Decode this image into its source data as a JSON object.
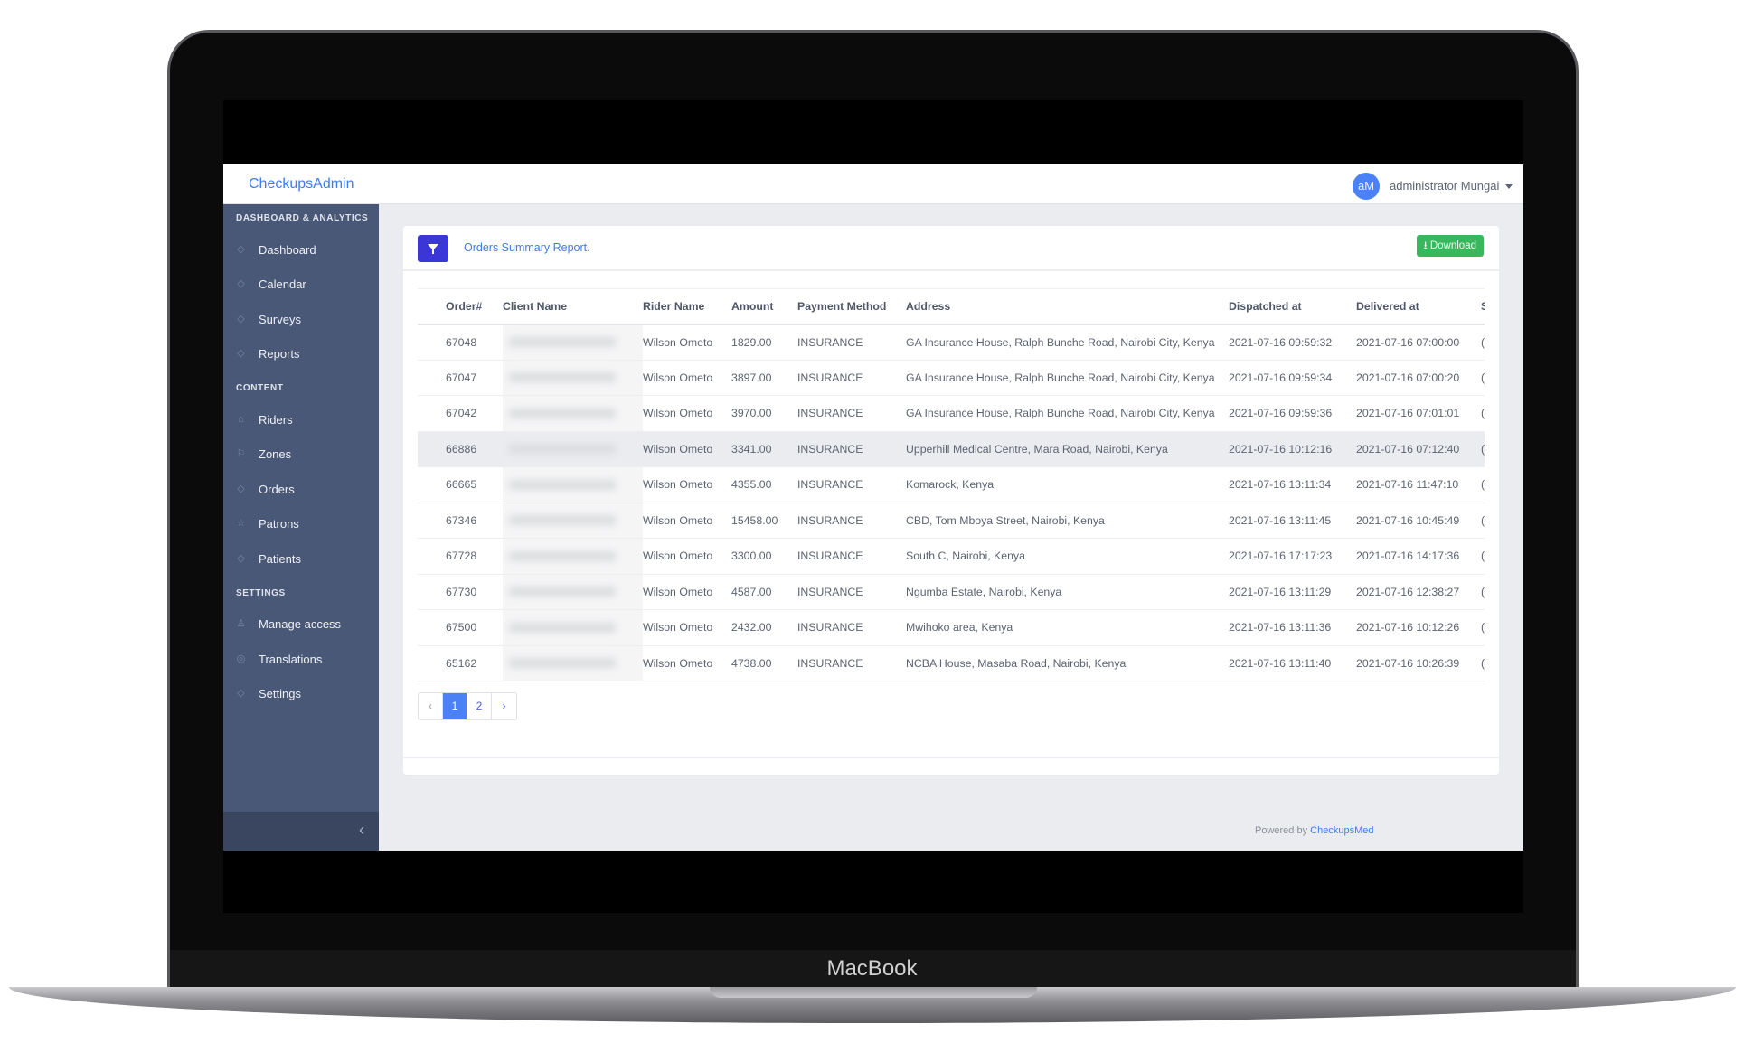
{
  "device": {
    "brand": "MacBook"
  },
  "header": {
    "logo": "CheckupsAdmin",
    "avatar_initials": "aM",
    "user_name": "administrator Mungai"
  },
  "sidebar": {
    "sections": [
      {
        "title": "DASHBOARD & ANALYTICS",
        "items": [
          {
            "label": "Dashboard",
            "icon": "diamond-icon"
          },
          {
            "label": "Calendar",
            "icon": "diamond-icon"
          },
          {
            "label": "Surveys",
            "icon": "diamond-icon"
          },
          {
            "label": "Reports",
            "icon": "diamond-icon"
          }
        ]
      },
      {
        "title": "CONTENT",
        "items": [
          {
            "label": "Riders",
            "icon": "graduation-cap-icon"
          },
          {
            "label": "Zones",
            "icon": "flag-icon"
          },
          {
            "label": "Orders",
            "icon": "diamond-icon"
          },
          {
            "label": "Patrons",
            "icon": "star-icon"
          },
          {
            "label": "Patients",
            "icon": "diamond-icon"
          }
        ]
      },
      {
        "title": "SETTINGS",
        "items": [
          {
            "label": "Manage access",
            "icon": "user-icon"
          },
          {
            "label": "Translations",
            "icon": "map-pin-icon"
          },
          {
            "label": "Settings",
            "icon": "diamond-icon"
          }
        ]
      }
    ],
    "collapse_icon": "‹"
  },
  "card": {
    "title": "Orders Summary Report.",
    "download_label": "Download",
    "accent": "#3a36d8",
    "download_color": "#39b75d"
  },
  "table": {
    "columns": [
      "Order#",
      "Client Name",
      "Rider Name",
      "Amount",
      "Payment Method",
      "Address",
      "Dispatched at",
      "Delivered at",
      "S"
    ],
    "rows": [
      {
        "order": "67048",
        "rider": "Wilson Ometo",
        "amount": "1829.00",
        "payment": "INSURANCE",
        "address": "GA Insurance House, Ralph Bunche Road, Nairobi City, Kenya",
        "dispatched": "2021-07-16 09:59:32",
        "delivered": "2021-07-16 07:00:00",
        "s": "("
      },
      {
        "order": "67047",
        "rider": "Wilson Ometo",
        "amount": "3897.00",
        "payment": "INSURANCE",
        "address": "GA Insurance House, Ralph Bunche Road, Nairobi City, Kenya",
        "dispatched": "2021-07-16 09:59:34",
        "delivered": "2021-07-16 07:00:20",
        "s": "("
      },
      {
        "order": "67042",
        "rider": "Wilson Ometo",
        "amount": "3970.00",
        "payment": "INSURANCE",
        "address": "GA Insurance House, Ralph Bunche Road, Nairobi City, Kenya",
        "dispatched": "2021-07-16 09:59:36",
        "delivered": "2021-07-16 07:01:01",
        "s": "("
      },
      {
        "order": "66886",
        "rider": "Wilson Ometo",
        "amount": "3341.00",
        "payment": "INSURANCE",
        "address": "Upperhill Medical Centre, Mara Road, Nairobi, Kenya",
        "dispatched": "2021-07-16 10:12:16",
        "delivered": "2021-07-16 07:12:40",
        "s": "("
      },
      {
        "order": "66665",
        "rider": "Wilson Ometo",
        "amount": "4355.00",
        "payment": "INSURANCE",
        "address": "Komarock, Kenya",
        "dispatched": "2021-07-16 13:11:34",
        "delivered": "2021-07-16 11:47:10",
        "s": "("
      },
      {
        "order": "67346",
        "rider": "Wilson Ometo",
        "amount": "15458.00",
        "payment": "INSURANCE",
        "address": "CBD, Tom Mboya Street, Nairobi, Kenya",
        "dispatched": "2021-07-16 13:11:45",
        "delivered": "2021-07-16 10:45:49",
        "s": "("
      },
      {
        "order": "67728",
        "rider": "Wilson Ometo",
        "amount": "3300.00",
        "payment": "INSURANCE",
        "address": "South C, Nairobi, Kenya",
        "dispatched": "2021-07-16 17:17:23",
        "delivered": "2021-07-16 14:17:36",
        "s": "("
      },
      {
        "order": "67730",
        "rider": "Wilson Ometo",
        "amount": "4587.00",
        "payment": "INSURANCE",
        "address": "Ngumba Estate, Nairobi, Kenya",
        "dispatched": "2021-07-16 13:11:29",
        "delivered": "2021-07-16 12:38:27",
        "s": "("
      },
      {
        "order": "67500",
        "rider": "Wilson Ometo",
        "amount": "2432.00",
        "payment": "INSURANCE",
        "address": "Mwihoko area, Kenya",
        "dispatched": "2021-07-16 13:11:36",
        "delivered": "2021-07-16 10:12:26",
        "s": "("
      },
      {
        "order": "65162",
        "rider": "Wilson Ometo",
        "amount": "4738.00",
        "payment": "INSURANCE",
        "address": "NCBA House, Masaba Road, Nairobi, Kenya",
        "dispatched": "2021-07-16 13:11:40",
        "delivered": "2021-07-16 10:26:39",
        "s": "("
      }
    ],
    "highlighted_row": 3
  },
  "pagination": {
    "prev": "‹",
    "pages": [
      "1",
      "2"
    ],
    "current": "1",
    "next": "›"
  },
  "footer": {
    "prefix": "Powered by",
    "link": "CheckupsMed"
  }
}
